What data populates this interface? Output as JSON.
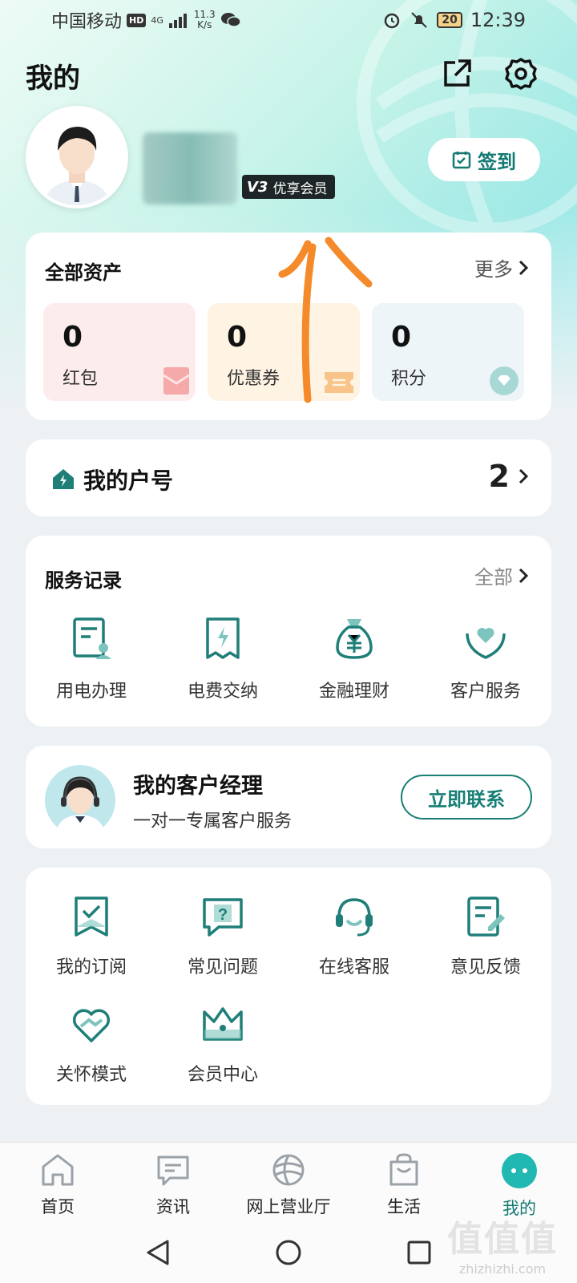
{
  "status_bar": {
    "carrier": "中国移动",
    "hd": "HD",
    "network": "4G",
    "speed_value": "11.3",
    "speed_unit": "K/s",
    "battery": "20",
    "time": "12:39"
  },
  "header": {
    "title": "我的"
  },
  "profile": {
    "vip_level": "V3",
    "vip_label": "优享会员",
    "checkin_label": "签到"
  },
  "assets": {
    "title": "全部资产",
    "more": "更多",
    "items": [
      {
        "value": "0",
        "label": "红包",
        "color": "#fdecec"
      },
      {
        "value": "0",
        "label": "优惠券",
        "color": "#fff4e4"
      },
      {
        "value": "0",
        "label": "积分",
        "color": "#eef5f8"
      }
    ]
  },
  "household": {
    "title": "我的户号",
    "count": "2"
  },
  "services": {
    "title": "服务记录",
    "more": "全部",
    "items": [
      {
        "label": "用电办理",
        "icon": "electricity-form-icon"
      },
      {
        "label": "电费交纳",
        "icon": "bill-payment-icon"
      },
      {
        "label": "金融理财",
        "icon": "money-bag-icon"
      },
      {
        "label": "客户服务",
        "icon": "heart-hands-icon"
      }
    ]
  },
  "manager": {
    "title": "我的客户经理",
    "subtitle": "一对一专属客户服务",
    "button": "立即联系"
  },
  "tools": {
    "items": [
      {
        "label": "我的订阅",
        "icon": "subscription-icon"
      },
      {
        "label": "常见问题",
        "icon": "faq-icon"
      },
      {
        "label": "在线客服",
        "icon": "headset-icon"
      },
      {
        "label": "意见反馈",
        "icon": "feedback-icon"
      },
      {
        "label": "关怀模式",
        "icon": "care-heart-icon"
      },
      {
        "label": "会员中心",
        "icon": "crown-icon"
      }
    ]
  },
  "bottom_nav": {
    "items": [
      {
        "label": "首页",
        "icon": "home-icon"
      },
      {
        "label": "资讯",
        "icon": "message-icon"
      },
      {
        "label": "网上营业厅",
        "icon": "globe-icon"
      },
      {
        "label": "生活",
        "icon": "shopping-bag-icon"
      },
      {
        "label": "我的",
        "icon": "profile-dots-icon",
        "active": true
      }
    ]
  },
  "watermark": {
    "big": "值值值",
    "small": "zhizhizhi.com"
  },
  "colors": {
    "accent": "#137a72",
    "icon_teal": "#1f7f78"
  }
}
